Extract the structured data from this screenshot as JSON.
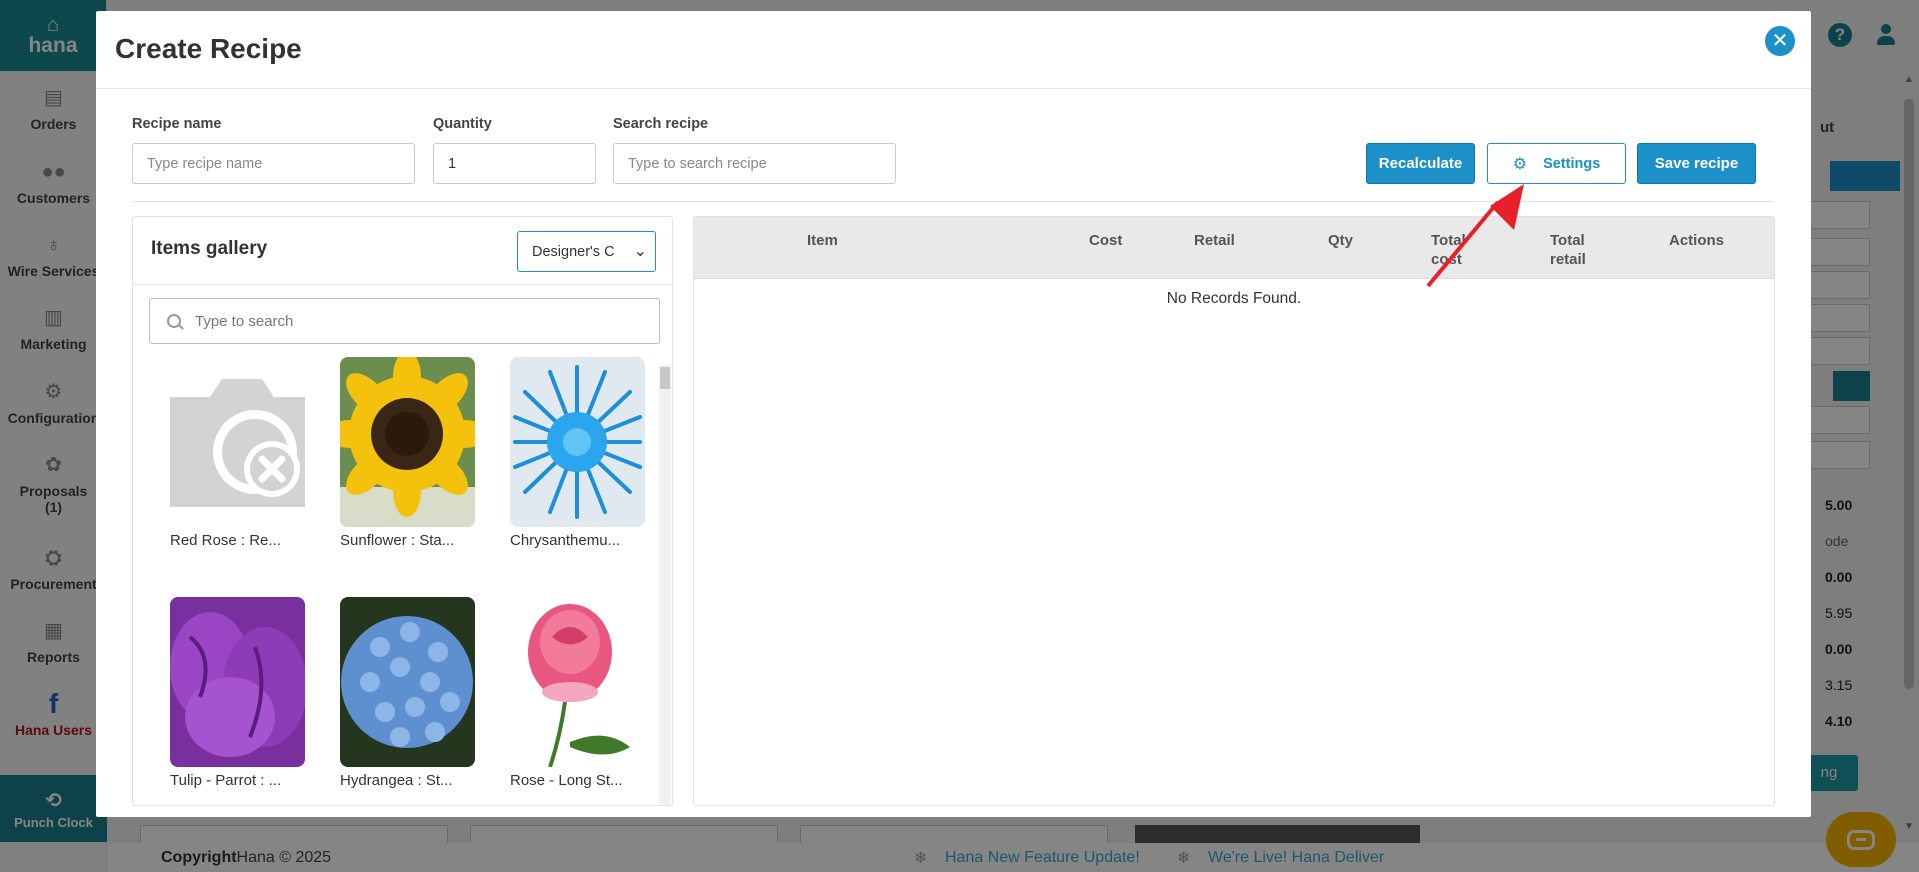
{
  "app": {
    "brand": "hana"
  },
  "sidebar": {
    "items": [
      {
        "label": "Orders",
        "icon": "orders-icon"
      },
      {
        "label": "Customers",
        "icon": "customers-icon"
      },
      {
        "label": "Wire Services",
        "icon": "wire-services-icon"
      },
      {
        "label": "Marketing",
        "icon": "marketing-icon"
      },
      {
        "label": "Configuration",
        "icon": "configuration-icon"
      },
      {
        "label": "Proposals",
        "sub": "(1)",
        "icon": "proposals-icon"
      },
      {
        "label": "Procurement",
        "icon": "procurement-icon"
      },
      {
        "label": "Reports",
        "icon": "reports-icon"
      },
      {
        "label": "Hana Users",
        "icon": "facebook-icon"
      }
    ],
    "punch_clock": "Punch Clock"
  },
  "right_panel": {
    "label": "ut",
    "values": [
      "5.00",
      "ode",
      "0.00",
      "5.95",
      "0.00",
      "3.15",
      "4.10"
    ],
    "button": "ng"
  },
  "footer": {
    "copyright_label": "Copyright",
    "copyright_text": "Hana © 2025",
    "ticker": [
      "Hana New Feature Update!",
      "We're Live! Hana Deliver"
    ]
  },
  "modal": {
    "title": "Create Recipe",
    "form": {
      "recipe_name": {
        "label": "Recipe name",
        "placeholder": "Type recipe name",
        "value": ""
      },
      "quantity": {
        "label": "Quantity",
        "value": "1"
      },
      "search_recipe": {
        "label": "Search recipe",
        "placeholder": "Type to search recipe",
        "value": ""
      }
    },
    "buttons": {
      "recalculate": "Recalculate",
      "settings": "Settings",
      "save": "Save recipe"
    },
    "gallery": {
      "title": "Items gallery",
      "filter_selected": "Designer's C",
      "search_placeholder": "Type to search",
      "items": [
        {
          "name": "Red Rose : Re...",
          "image": "placeholder"
        },
        {
          "name": "Sunflower : Sta...",
          "image": "sunflower"
        },
        {
          "name": "Chrysanthemu...",
          "image": "chrysanthemum"
        },
        {
          "name": "Tulip - Parrot : ...",
          "image": "tulip"
        },
        {
          "name": "Hydrangea : St...",
          "image": "hydrangea"
        },
        {
          "name": "Rose - Long St...",
          "image": "rose"
        }
      ]
    },
    "table": {
      "columns": [
        "Item",
        "Cost",
        "Retail",
        "Qty",
        "Total cost",
        "Total retail",
        "Actions"
      ],
      "empty_message": "No Records Found."
    }
  },
  "colors": {
    "primary": "#1b90c9",
    "brand_teal": "#1a8a94",
    "annotation_arrow": "#e8202a"
  }
}
